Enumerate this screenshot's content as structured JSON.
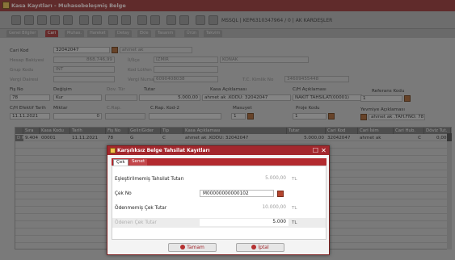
{
  "window": {
    "title": "Kasa Kayıtları - Muhasebeleşmiş Belge",
    "company_info": "MSSQL | KEP6310347964 / 0 | AK KARDEŞLER"
  },
  "tabs": [
    "Genel Bilgiler",
    "Cari",
    "Muhas.",
    "Hareket",
    "Detay",
    "Ekle",
    "Tasarım",
    "Ürün",
    "Takvim"
  ],
  "active_tab": "Cari",
  "form": {
    "cari_kod_label": "Cari Kod",
    "cari_kod_value": "32042047",
    "cari_name": "ahmet ak",
    "hesap_bakiyesi_label": "Hesap Bakiyesi",
    "hesap_bakiyesi_value": "868.746,99",
    "il_ilce_label": "İl/İlçe",
    "il_value": "IZMIR",
    "ilce_value": "KONAK",
    "grup_kodu_label": "Grup Kodu",
    "grup_kodu_value": "INT",
    "kod_label": "Kod Lütfen 2",
    "vergi_dairesi_label": "Vergi Dairesi",
    "vergi_numarasi_label": "Vergi Numarası",
    "vergi_numarasi_value": "6090408038",
    "tc_label": "T.C. Kimlik No",
    "tc_value": "34609455448",
    "fis_no_label": "Fiş No",
    "fis_no_value": "78",
    "degisim_label": "Değişim",
    "degisim_value": "Kur",
    "doviz_label": "Dov. Tür",
    "tutar_label": "Tutar",
    "tutar_value": "5.000,00",
    "kasa_aciklamasi_label": "Kasa Açıklaması",
    "kasa_aciklamasi_value": "ahmet ak .KODU: 32042047",
    "ch_aciklamasi_label": "C/H Açıklaması",
    "ch_aciklamasi_value": "NAKİT TAHSILAT(00001)",
    "referans_kodu_label": "Referans Kodu",
    "referans_kodu_value": "1",
    "ch_efektif_label": "C/H Efektif Tarih",
    "ch_efektif_value": "11.11.2021",
    "miktar_label": "Miktar",
    "miktar_value": "0",
    "c_rap_label": "C.Rap.",
    "c_rap_kod_label": "C.Rap. Kod-2",
    "mesuyet_label": "Masuyet",
    "mesuyet_value": "1",
    "proje_kodu_label": "Proje Kodu",
    "proje_kodu_value": "1",
    "yevmiye_label": "Yevmiye Açıklaması",
    "yevmiye_value": "ahmet ak .TAH.FNO: 78"
  },
  "grid": {
    "headers": [
      "",
      "Sıra",
      "Kasa Kodu",
      "Tarih",
      "Fiş No",
      "Gelir/Gider",
      "Tip",
      "Kasa Açıklaması",
      "Tutar",
      "Cari Kod",
      "Cari İsim",
      "Cari Hub.",
      "Döviz Tut."
    ],
    "rows": [
      [
        "D K",
        "9.404",
        "00001",
        "11.11.2021",
        "78",
        "G",
        "C",
        "ahmet ak .KODU: 32042047",
        "5.000,00",
        "32042047",
        "ahmet ak",
        "C",
        "0,000"
      ]
    ]
  },
  "modal": {
    "title": "Karşılıksız Belge Tahsilat Kayıtları",
    "tabs": [
      "Çek",
      "Senet"
    ],
    "active_tab": "Çek",
    "rows": [
      {
        "label": "Eşleştirilmemiş Tahsilat Tutarı",
        "value": "5.000,00",
        "unit": "TL"
      },
      {
        "label": "Çek No",
        "value": "M00000000000102",
        "unit": ""
      },
      {
        "label": "Ödenmemiş Çek Tutar",
        "value": "10.000,00",
        "unit": "TL"
      },
      {
        "label": "Ödenen Çek Tutar",
        "value": "5.000",
        "unit": "TL"
      }
    ],
    "ok_label": "Tamam",
    "cancel_label": "İptal"
  }
}
